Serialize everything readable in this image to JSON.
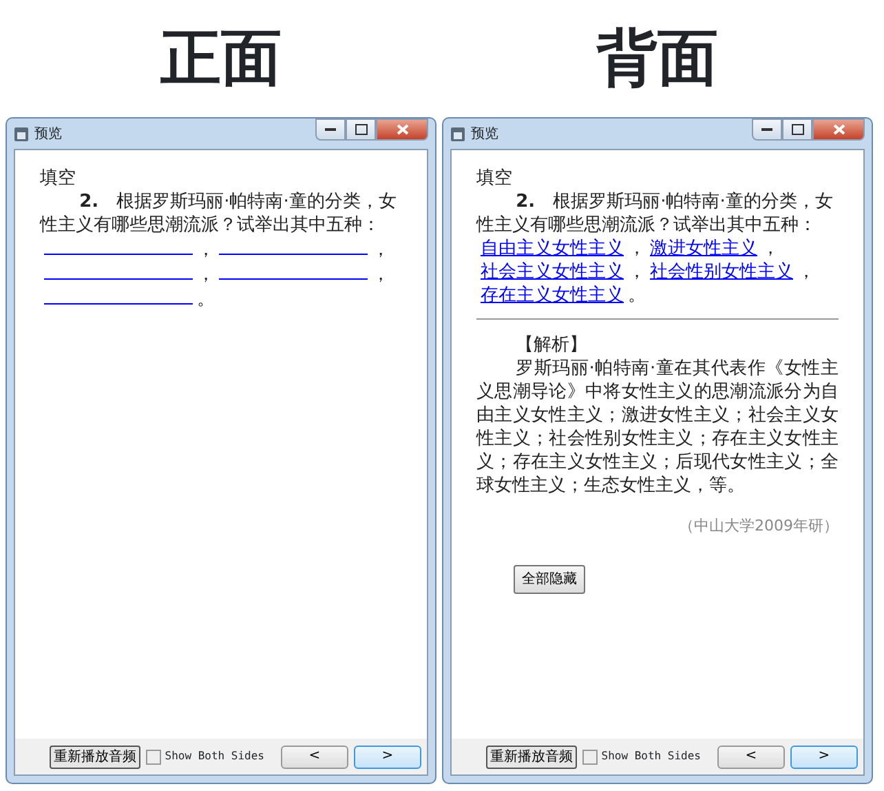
{
  "windows": [
    {
      "heading": "正面",
      "title": "预览",
      "section_label": "填空",
      "question": "**2.**　根据罗斯玛丽·帕特南·童的分类，女性主义有哪些思潮流派？试举出其中五种：",
      "answer_line": [
        {
          "kind": "blank"
        },
        {
          "kind": "punct",
          "text": "，"
        },
        {
          "kind": "blank"
        },
        {
          "kind": "punct",
          "text": "，"
        },
        {
          "kind": "blank"
        },
        {
          "kind": "punct",
          "text": "，"
        },
        {
          "kind": "blank"
        },
        {
          "kind": "punct",
          "text": "，"
        },
        {
          "kind": "blank"
        },
        {
          "kind": "punct",
          "text": "。"
        }
      ],
      "footer": {
        "replay_button": "重新播放音频",
        "show_both_sides": {
          "label": "Show Both Sides",
          "checked": false
        },
        "nav_buttons": [
          {
            "label": "<",
            "focused": false
          },
          {
            "label": ">",
            "focused": true
          }
        ]
      }
    },
    {
      "heading": "背面",
      "title": "预览",
      "section_label": "填空",
      "question": "**2.**　根据罗斯玛丽·帕特南·童的分类，女性主义有哪些思潮流派？试举出其中五种：",
      "answer_line": [
        {
          "kind": "answer",
          "text": "自由主义女性主义"
        },
        {
          "kind": "punct",
          "text": "，"
        },
        {
          "kind": "answer",
          "text": "激进女性主义"
        },
        {
          "kind": "punct",
          "text": "，"
        },
        {
          "kind": "answer",
          "text": "社会主义女性主义"
        },
        {
          "kind": "punct",
          "text": "，"
        },
        {
          "kind": "answer",
          "text": "社会性别女性主义"
        },
        {
          "kind": "punct",
          "text": "，"
        },
        {
          "kind": "answer",
          "text": "存在主义女性主义"
        },
        {
          "kind": "punct",
          "text": "。"
        }
      ],
      "analysis": {
        "heading": "【解析】",
        "text": "罗斯玛丽·帕特南·童在其代表作《女性主义思潮导论》中将女性主义的思潮流派分为自由主义女性主义；激进女性主义；社会主义女性主义；社会性别女性主义；存在主义女性主义；存在主义女性主义；后现代女性主义；全球女性主义；生态女性主义，等。",
        "source": "（中山大学2009年研）"
      },
      "toggle_button": "全部隐藏",
      "footer": {
        "replay_button": "重新播放音频",
        "show_both_sides": {
          "label": "Show Both Sides",
          "checked": false
        },
        "nav_buttons": [
          {
            "label": "<",
            "focused": false
          },
          {
            "label": ">",
            "focused": true
          }
        ]
      }
    }
  ]
}
